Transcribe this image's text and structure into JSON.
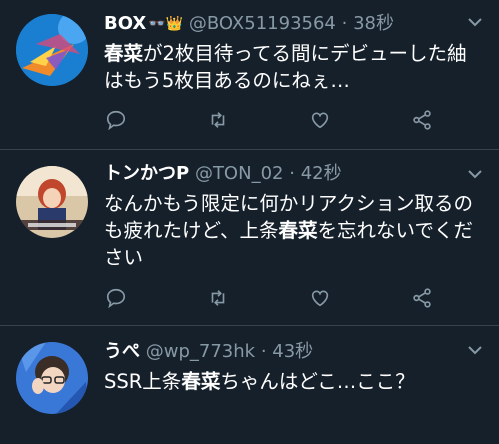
{
  "tweets": [
    {
      "name": "BOX",
      "badges": "👓👑",
      "handle": "@BOX51193564",
      "dot": "·",
      "time": "38秒",
      "text_parts": [
        {
          "t": "春菜",
          "hl": true
        },
        {
          "t": "が2枚目待ってる間にデビューした紬はもう5枚目あるのにねぇ…",
          "hl": false
        }
      ]
    },
    {
      "name": "トンかつP",
      "handle": "@TON_02",
      "dot": "·",
      "time": "42秒",
      "text_parts": [
        {
          "t": "なんかもう限定に何かリアクション取るのも疲れたけど、上条",
          "hl": false
        },
        {
          "t": "春菜",
          "hl": true
        },
        {
          "t": "を忘れないでください",
          "hl": false
        }
      ]
    },
    {
      "name": "うぺ",
      "handle": "@wp_773hk",
      "dot": "·",
      "time": "43秒",
      "text_parts": [
        {
          "t": "SSR上条",
          "hl": false
        },
        {
          "t": "春菜",
          "hl": true
        },
        {
          "t": "ちゃんはどこ…ここ？",
          "hl": false
        }
      ]
    }
  ],
  "icons": {
    "reply": "reply-icon",
    "retweet": "retweet-icon",
    "like": "like-icon",
    "share": "share-icon",
    "caret": "chevron-down-icon"
  },
  "colors": {
    "background": "#15202b",
    "secondary_text": "#8899a6",
    "divider": "#38444d",
    "icon": "#8899a6"
  }
}
